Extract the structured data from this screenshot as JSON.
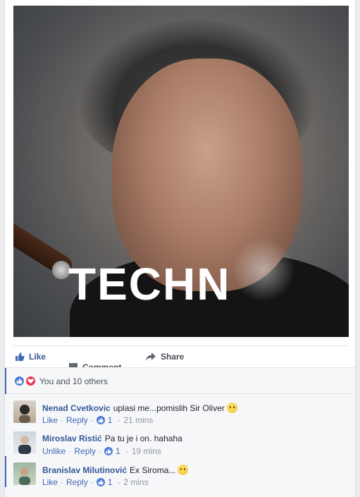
{
  "post": {
    "image_overlay_text": "TECHN"
  },
  "actions": {
    "like_label": "Like",
    "comment_label": "Comment",
    "share_label": "Share"
  },
  "reactions": {
    "summary": "You and 10 others",
    "icons": [
      "like-reaction-icon",
      "love-reaction-icon"
    ]
  },
  "comments": [
    {
      "author": "Nenad Cvetkovic",
      "text": "uplasi me...pomislih Sir Oliver",
      "emoji": "smile",
      "action1": "Like",
      "reply": "Reply",
      "likes": "1",
      "time": "21 mins"
    },
    {
      "author": "Miroslav Ristić",
      "text": "Pa tu je i on. hahaha",
      "emoji": "",
      "action1": "Unlike",
      "reply": "Reply",
      "likes": "1",
      "time": "19 mins"
    },
    {
      "author": "Branislav Milutinović",
      "text": "Ex Siroma...",
      "emoji": "smile",
      "action1": "Like",
      "reply": "Reply",
      "likes": "1",
      "time": "2 mins"
    }
  ],
  "colors": {
    "link": "#365899",
    "accent": "#4267b2",
    "muted": "#90949c",
    "like_blue": "#4c7bd9",
    "love_red": "#e8364f"
  }
}
